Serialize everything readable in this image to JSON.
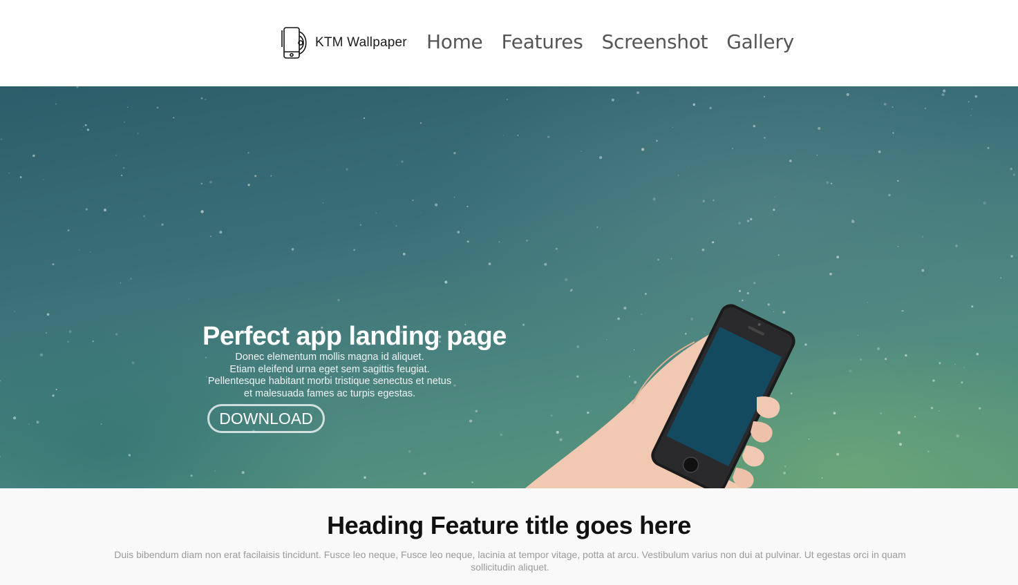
{
  "header": {
    "logo_text": "KTM Wallpaper",
    "logo_icon": "phone-wallpaper-logo-icon",
    "nav": [
      {
        "label": "Home"
      },
      {
        "label": "Features"
      },
      {
        "label": "Screenshot"
      },
      {
        "label": "Gallery"
      }
    ]
  },
  "hero": {
    "title": "Perfect app landing page",
    "lines": [
      "Donec elementum mollis magna id aliquet.",
      "Etiam eleifend urna eget sem sagittis feugiat.",
      "Pellentesque habitant morbi tristique senectus et netus",
      "et malesuada fames ac turpis egestas."
    ],
    "button_label": "DOWNLOAD",
    "image": "hand-holding-phone"
  },
  "features": {
    "title": "Heading Feature title goes here",
    "text": "Duis bibendum diam non erat facilaisis tincidunt. Fusce leo neque, Fusce leo neque, lacinia at tempor vitage, potta at arcu. Vestibulum varius non dui at pulvinar. Ut egestas orci in quam sollicitudin aliquet."
  },
  "colors": {
    "hero_start": "#2c5d6a",
    "hero_end": "#5a9a78",
    "nav_text": "#555555",
    "features_bg": "#f9f9f9",
    "phone_screen": "#134a60"
  }
}
